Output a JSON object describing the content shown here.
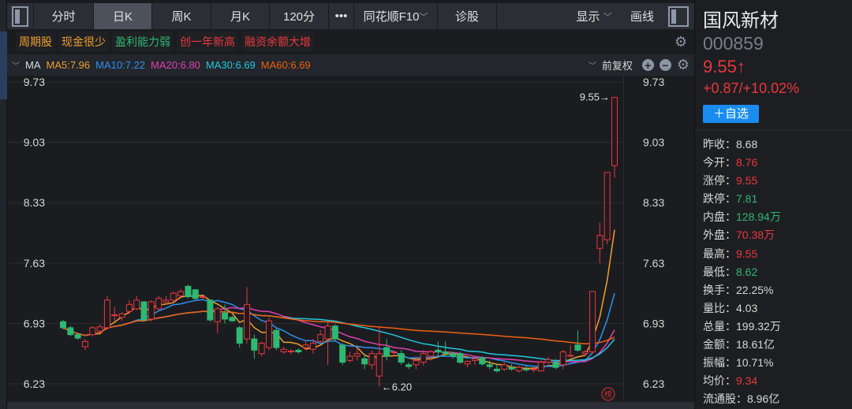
{
  "toolbar": {
    "tabs": [
      "分时",
      "日K",
      "周K",
      "月K",
      "120分"
    ],
    "active": "日K",
    "more": "•••",
    "f10": "同花顺F10",
    "f10_caret": "﹀",
    "diagnose": "诊股",
    "display": "显示",
    "display_caret": "﹀",
    "draw": "画线"
  },
  "tags": [
    {
      "label": "周期股",
      "color": "#f0a030"
    },
    {
      "label": "现金很少",
      "color": "#f0a030"
    },
    {
      "label": "盈利能力弱",
      "color": "#2eb872"
    },
    {
      "label": "创一年新高",
      "color": "#e8383d"
    },
    {
      "label": "融资余额大增",
      "color": "#e8383d"
    }
  ],
  "ma_bar": {
    "caret": "﹀",
    "label": "MA",
    "items": [
      {
        "text": "MA5:7.96",
        "color": "#f0a030"
      },
      {
        "text": "MA10:7.22",
        "color": "#2f90f0"
      },
      {
        "text": "MA20:6.80",
        "color": "#e040b0"
      },
      {
        "text": "MA30:6.69",
        "color": "#20c8e0"
      },
      {
        "text": "MA60:6.69",
        "color": "#f06010"
      }
    ],
    "adjust": "前复权"
  },
  "chart_data": {
    "type": "candlestick",
    "ylim": [
      6.23,
      9.73
    ],
    "y_ticks": [
      "9.73",
      "9.03",
      "8.33",
      "7.63",
      "6.93",
      "6.23"
    ],
    "high_label": "9.55→",
    "low_label": "←6.20",
    "badge": "榜",
    "candles": [
      [
        6.95,
        6.97,
        6.86,
        6.88
      ],
      [
        6.88,
        6.9,
        6.78,
        6.8
      ],
      [
        6.8,
        6.82,
        6.74,
        6.76
      ],
      [
        6.66,
        6.75,
        6.62,
        6.72
      ],
      [
        6.8,
        6.9,
        6.78,
        6.88
      ],
      [
        6.84,
        6.92,
        6.82,
        6.89
      ],
      [
        6.88,
        7.25,
        6.86,
        7.2
      ],
      [
        7.02,
        7.12,
        6.95,
        7.03
      ],
      [
        7.0,
        7.06,
        6.96,
        7.04
      ],
      [
        7.07,
        7.2,
        7.04,
        7.15
      ],
      [
        7.1,
        7.25,
        7.08,
        7.2
      ],
      [
        7.18,
        7.19,
        6.95,
        6.97
      ],
      [
        6.98,
        7.2,
        6.95,
        7.18
      ],
      [
        7.1,
        7.25,
        7.08,
        7.22
      ],
      [
        7.18,
        7.25,
        7.15,
        7.2
      ],
      [
        7.2,
        7.3,
        7.18,
        7.28
      ],
      [
        7.25,
        7.33,
        7.22,
        7.3
      ],
      [
        7.36,
        7.38,
        7.22,
        7.24
      ],
      [
        7.32,
        7.33,
        7.2,
        7.22
      ],
      [
        7.23,
        7.25,
        7.21,
        7.24
      ],
      [
        7.2,
        7.21,
        6.95,
        6.97
      ],
      [
        6.95,
        7.12,
        6.82,
        7.1
      ],
      [
        7.05,
        7.15,
        6.93,
        6.98
      ],
      [
        7.0,
        7.02,
        6.95,
        6.96
      ],
      [
        6.88,
        6.9,
        6.65,
        6.7
      ],
      [
        6.75,
        7.35,
        6.7,
        7.15
      ],
      [
        6.75,
        6.8,
        6.52,
        6.62
      ],
      [
        6.58,
        6.72,
        6.55,
        6.7
      ],
      [
        6.65,
        7.0,
        6.62,
        6.96
      ],
      [
        6.85,
        6.88,
        6.62,
        6.65
      ],
      [
        6.6,
        6.66,
        6.58,
        6.63
      ],
      [
        6.6,
        6.63,
        6.57,
        6.61
      ],
      [
        6.62,
        6.64,
        6.58,
        6.6
      ],
      [
        6.65,
        6.72,
        6.62,
        6.68
      ],
      [
        6.63,
        6.75,
        6.58,
        6.7
      ],
      [
        6.72,
        6.85,
        6.7,
        6.8
      ],
      [
        6.75,
        6.95,
        6.45,
        6.9
      ],
      [
        6.9,
        6.92,
        6.72,
        6.75
      ],
      [
        6.68,
        6.7,
        6.45,
        6.48
      ],
      [
        6.5,
        6.6,
        6.48,
        6.55
      ],
      [
        6.55,
        6.65,
        6.5,
        6.58
      ],
      [
        6.52,
        6.58,
        6.4,
        6.46
      ],
      [
        6.45,
        6.62,
        6.4,
        6.58
      ],
      [
        6.32,
        6.9,
        6.2,
        6.58
      ],
      [
        6.65,
        6.75,
        6.5,
        6.55
      ],
      [
        6.6,
        6.62,
        6.55,
        6.6
      ],
      [
        6.58,
        6.62,
        6.45,
        6.48
      ],
      [
        6.45,
        6.48,
        6.4,
        6.43
      ],
      [
        6.45,
        6.55,
        6.4,
        6.5
      ],
      [
        6.48,
        6.62,
        6.44,
        6.58
      ],
      [
        6.55,
        6.62,
        6.5,
        6.6
      ],
      [
        6.62,
        6.72,
        6.55,
        6.6
      ],
      [
        6.6,
        6.72,
        6.55,
        6.58
      ],
      [
        6.58,
        6.6,
        6.52,
        6.55
      ],
      [
        6.58,
        6.6,
        6.46,
        6.48
      ],
      [
        6.46,
        6.5,
        6.42,
        6.49
      ],
      [
        6.5,
        6.55,
        6.45,
        6.52
      ],
      [
        6.53,
        6.55,
        6.44,
        6.46
      ],
      [
        6.45,
        6.5,
        6.4,
        6.43
      ],
      [
        6.4,
        6.45,
        6.36,
        6.38
      ],
      [
        6.4,
        6.48,
        6.38,
        6.45
      ],
      [
        6.42,
        6.46,
        6.38,
        6.4
      ],
      [
        6.38,
        6.44,
        6.36,
        6.42
      ],
      [
        6.4,
        6.45,
        6.37,
        6.39
      ],
      [
        6.4,
        6.42,
        6.36,
        6.4
      ],
      [
        6.38,
        6.5,
        6.37,
        6.48
      ],
      [
        6.48,
        6.54,
        6.46,
        6.51
      ],
      [
        6.48,
        6.52,
        6.4,
        6.42
      ],
      [
        6.45,
        6.62,
        6.4,
        6.6
      ],
      [
        6.55,
        6.68,
        6.54,
        6.56
      ],
      [
        6.68,
        6.85,
        6.6,
        6.62
      ],
      [
        6.58,
        6.62,
        6.55,
        6.6
      ],
      [
        6.6,
        7.3,
        6.58,
        7.3
      ],
      [
        7.8,
        8.1,
        7.63,
        7.95
      ],
      [
        7.9,
        8.68,
        7.85,
        8.68
      ],
      [
        8.76,
        9.55,
        8.62,
        9.55
      ]
    ],
    "ma_periods": [
      5,
      10,
      20,
      30,
      60
    ],
    "ma_colors": [
      "#f0a030",
      "#2f90f0",
      "#e040b0",
      "#20c8e0",
      "#f06010"
    ],
    "up_color": "#e8383d",
    "down_color": "#2eb872"
  },
  "stock": {
    "name": "国风新材",
    "code": "000859",
    "price": "9.55↑",
    "change": "+0.87/+10.02%",
    "add_label": "＋自选",
    "stats": [
      {
        "label": "昨收：",
        "value": "8.68",
        "cls": ""
      },
      {
        "label": "今开：",
        "value": "8.76",
        "cls": "red"
      },
      {
        "label": "涨停：",
        "value": "9.55",
        "cls": "red"
      },
      {
        "label": "跌停：",
        "value": "7.81",
        "cls": "green"
      },
      {
        "label": "内盘：",
        "value": "128.94万",
        "cls": "green"
      },
      {
        "label": "外盘：",
        "value": "70.38万",
        "cls": "red"
      },
      {
        "label": "最高：",
        "value": "9.55",
        "cls": "red"
      },
      {
        "label": "最低：",
        "value": "8.62",
        "cls": "green"
      },
      {
        "label": "换手：",
        "value": "22.25%",
        "cls": ""
      },
      {
        "label": "量比：",
        "value": "4.03",
        "cls": ""
      },
      {
        "label": "总量：",
        "value": "199.32万",
        "cls": ""
      },
      {
        "label": "金额：",
        "value": "18.61亿",
        "cls": ""
      },
      {
        "label": "振幅：",
        "value": "10.71%",
        "cls": ""
      },
      {
        "label": "均价：",
        "value": "9.34",
        "cls": "red"
      },
      {
        "label": "流通股：",
        "value": "8.96亿",
        "cls": ""
      }
    ]
  }
}
